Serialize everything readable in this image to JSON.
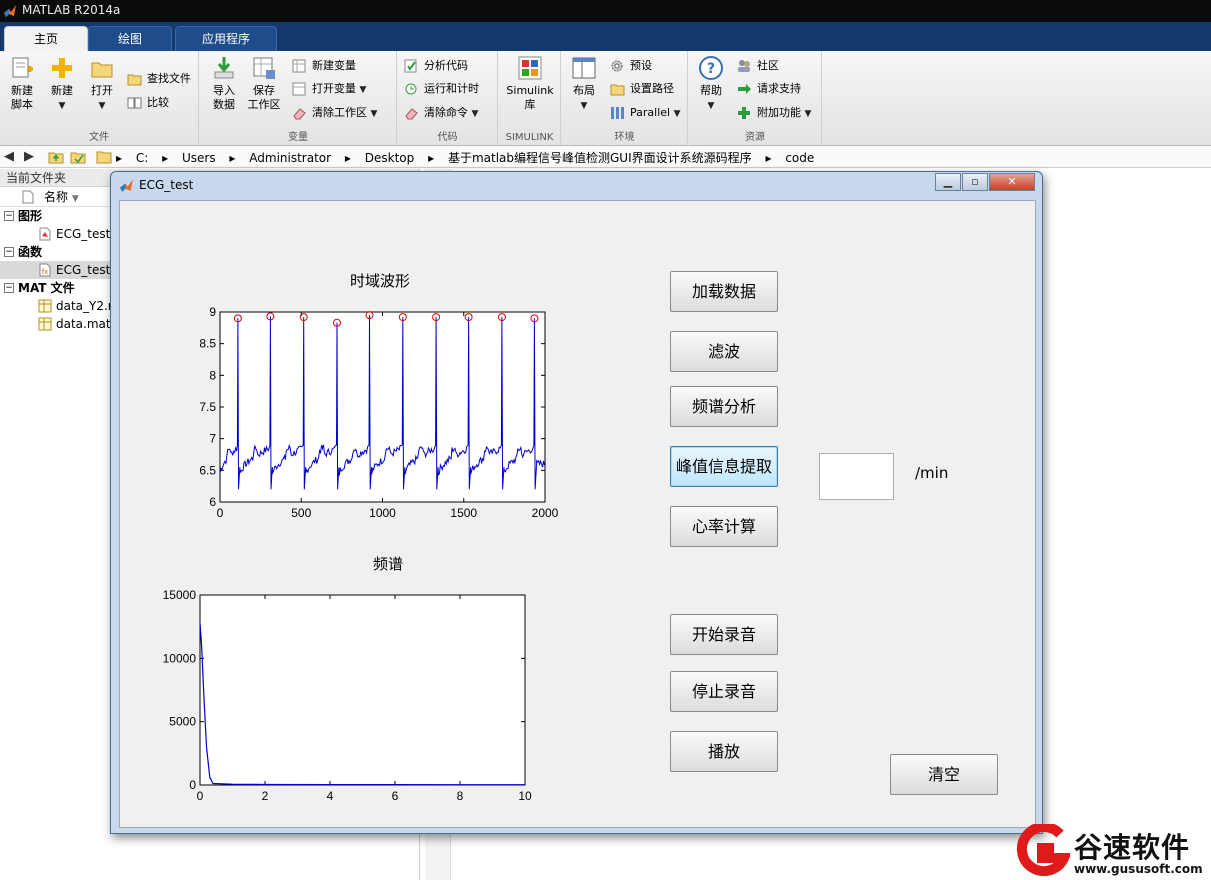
{
  "app": {
    "title": "MATLAB R2014a"
  },
  "tabs": [
    {
      "label": "主页"
    },
    {
      "label": "绘图"
    },
    {
      "label": "应用程序"
    }
  ],
  "ribbon": {
    "file": {
      "label": "文件",
      "new_script": "新建\n脚本",
      "new": "新建",
      "open": "打开",
      "find_files": "查找文件",
      "compare": "比较"
    },
    "variable": {
      "label": "变量",
      "import_data": "导入\n数据",
      "save_workspace": "保存\n工作区",
      "new_variable": "新建变量",
      "open_variable": "打开变量",
      "clear_workspace": "清除工作区"
    },
    "code": {
      "label": "代码",
      "analyze_code": "分析代码",
      "run_and_time": "运行和计时",
      "clear_commands": "清除命令"
    },
    "simulink": {
      "label": "SIMULINK",
      "library": "Simulink\n库"
    },
    "environment": {
      "label": "环境",
      "layout": "布局",
      "preferences": "预设",
      "set_path": "设置路径",
      "parallel": "Parallel"
    },
    "resources": {
      "label": "资源",
      "help": "帮助",
      "community": "社区",
      "request_support": "请求支持",
      "add_ons": "附加功能"
    }
  },
  "address": {
    "segments": [
      "C:",
      "Users",
      "Administrator",
      "Desktop",
      "基于matlab编程信号峰值检测GUI界面设计系统源码程序",
      "code"
    ]
  },
  "file_panel": {
    "title": "当前文件夹",
    "column": "名称",
    "groups": [
      {
        "label": "图形",
        "files": [
          {
            "name": "ECG_test.",
            "selected": false
          }
        ]
      },
      {
        "label": "函数",
        "files": [
          {
            "name": "ECG_test.",
            "selected": true
          }
        ]
      },
      {
        "label": "MAT 文件",
        "files": [
          {
            "name": "data_Y2.r",
            "selected": false
          },
          {
            "name": "data.mat",
            "selected": false
          }
        ]
      }
    ]
  },
  "figure": {
    "title": "ECG_test",
    "buttons": {
      "load": "加载数据",
      "filter": "滤波",
      "spectrum": "频谱分析",
      "peak": "峰值信息提取",
      "heart_rate": "心率计算",
      "rec_start": "开始录音",
      "rec_stop": "停止录音",
      "play": "播放",
      "clear": "清空"
    },
    "edit_value": "",
    "unit": "/min"
  },
  "chart_data": [
    {
      "type": "line",
      "title": "时域波形",
      "xlabel": "",
      "ylabel": "",
      "xlim": [
        0,
        2000
      ],
      "ylim": [
        6,
        9
      ],
      "xticks": [
        0,
        500,
        1000,
        1500,
        2000
      ],
      "yticks": [
        6,
        6.5,
        7,
        7.5,
        8,
        8.5,
        9
      ],
      "line_color": "#0000cc",
      "marker_color": "#dd0000",
      "baseline_ranges": [
        [
          6.3,
          6.9
        ]
      ],
      "peaks": [
        {
          "x": 110,
          "y": 8.9
        },
        {
          "x": 310,
          "y": 8.93
        },
        {
          "x": 515,
          "y": 8.92
        },
        {
          "x": 720,
          "y": 8.83
        },
        {
          "x": 920,
          "y": 8.95
        },
        {
          "x": 1125,
          "y": 8.92
        },
        {
          "x": 1330,
          "y": 8.92
        },
        {
          "x": 1530,
          "y": 8.92
        },
        {
          "x": 1735,
          "y": 8.92
        },
        {
          "x": 1935,
          "y": 8.9
        }
      ]
    },
    {
      "type": "line",
      "title": "频谱",
      "xlabel": "",
      "ylabel": "",
      "xlim": [
        0,
        10
      ],
      "ylim": [
        0,
        15000
      ],
      "xticks": [
        0,
        2,
        4,
        6,
        8,
        10
      ],
      "yticks": [
        0,
        5000,
        10000,
        15000
      ],
      "line_color": "#0000cc",
      "x": [
        0,
        0.05,
        0.12,
        0.2,
        0.3,
        0.4,
        1,
        2,
        4,
        6,
        8,
        10
      ],
      "y": [
        12800,
        11000,
        7000,
        3000,
        600,
        120,
        60,
        40,
        35,
        30,
        25,
        20
      ]
    }
  ]
}
